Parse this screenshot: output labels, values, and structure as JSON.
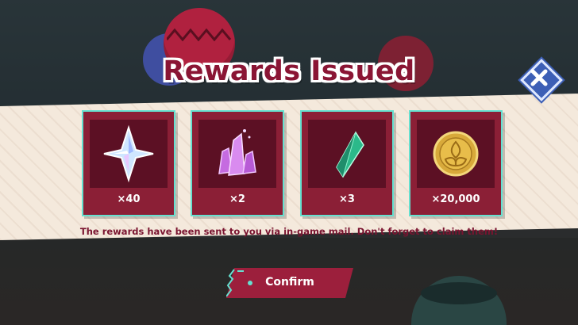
{
  "dialog": {
    "title": "Rewards Issued",
    "message": "The rewards have been sent to you via in-game mail. Don't forget to claim them!",
    "confirm_label": "Confirm"
  },
  "rewards": [
    {
      "item": "primogem-icon",
      "quantity": "×40"
    },
    {
      "item": "crystal-icon",
      "quantity": "×2"
    },
    {
      "item": "green-crystal-shard-icon",
      "quantity": "×3"
    },
    {
      "item": "mora-coin-icon",
      "quantity": "×20,000"
    }
  ],
  "colors": {
    "accent_crimson": "#8b1f36",
    "card_border": "#66e0d0",
    "banner": "#f4e9dc",
    "close_button": "#3d5fb6"
  }
}
